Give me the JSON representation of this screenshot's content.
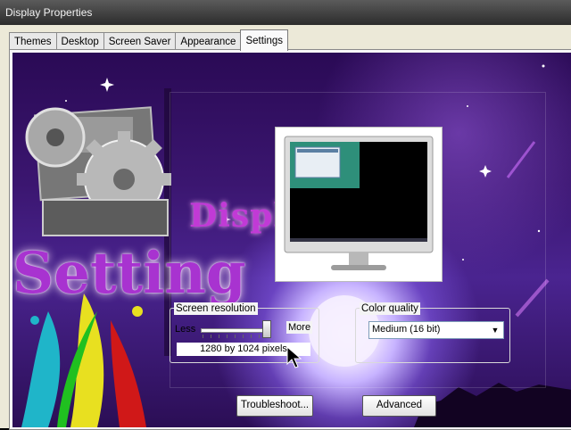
{
  "window": {
    "title": "Display Properties"
  },
  "tabs": [
    {
      "label": "Themes"
    },
    {
      "label": "Desktop"
    },
    {
      "label": "Screen Saver"
    },
    {
      "label": "Appearance"
    },
    {
      "label": "Settings",
      "active": true
    }
  ],
  "wallpaper": {
    "disp_text": "Displ",
    "setting_text": "Setting"
  },
  "screen_resolution": {
    "group_label": "Screen resolution",
    "less_label": "Less",
    "more_label": "More",
    "value": "1280 by 1024 pixels",
    "slider_level": "max"
  },
  "color_quality": {
    "group_label": "Color quality",
    "selected": "Medium (16 bit)",
    "arrow_icon": "chevron-down-icon"
  },
  "buttons": {
    "troubleshoot": "Troubleshoot...",
    "advanced": "Advanced"
  },
  "colors": {
    "accent_purple": "#a833d0",
    "background": "#2a0a55"
  }
}
